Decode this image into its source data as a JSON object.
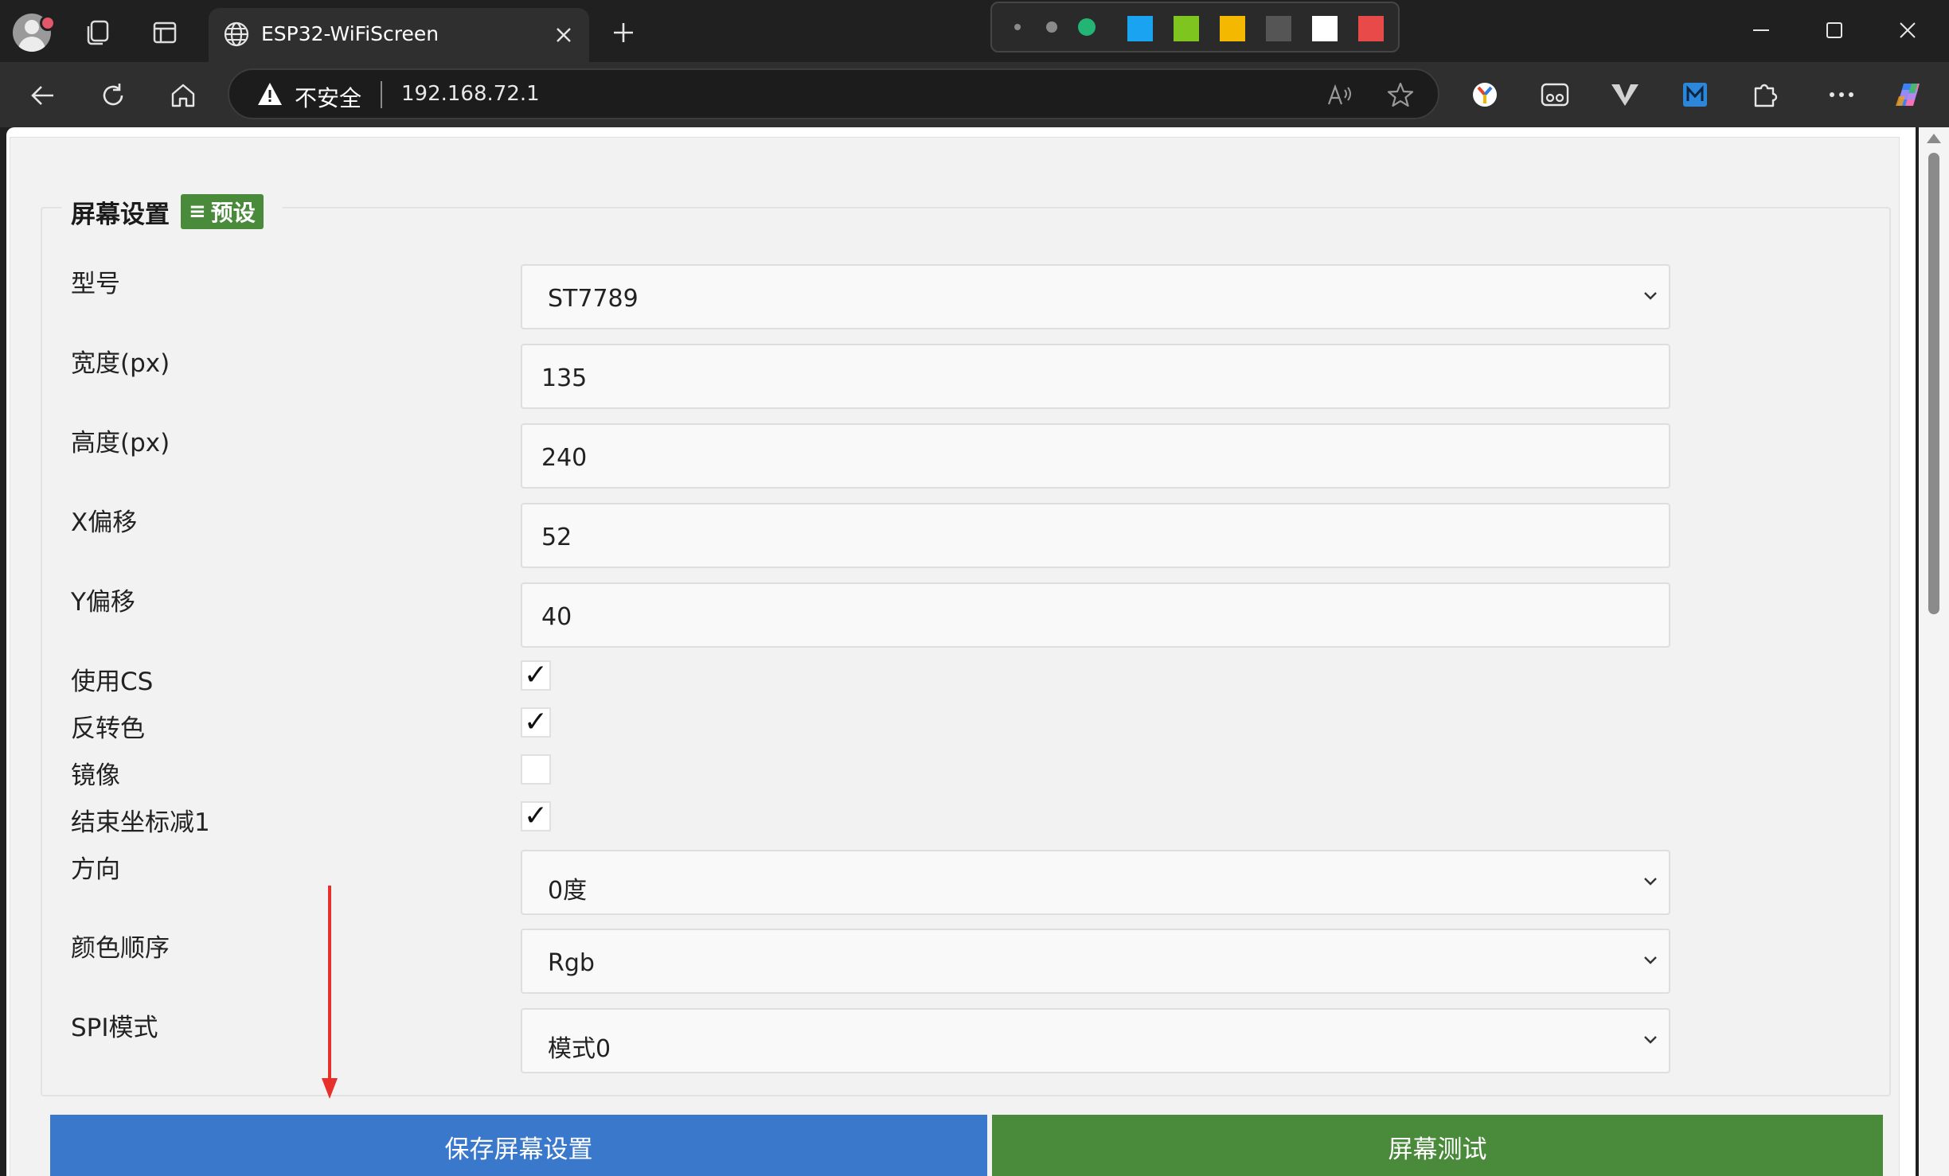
{
  "browser": {
    "tab_title": "ESP32-WiFiScreen",
    "security_label": "不安全",
    "url": "192.168.72.1",
    "palette_colors": [
      "#1aa3f0",
      "#7ec51f",
      "#f5b800",
      "#555555",
      "#ffffff",
      "#e84a4a"
    ]
  },
  "settings": {
    "legend_title": "屏幕设置",
    "preset_glyph": "≡",
    "preset_label": "预设",
    "model_label": "型号",
    "model_value": "ST7789",
    "width_label": "宽度(px)",
    "width_value": "135",
    "height_label": "高度(px)",
    "height_value": "240",
    "xoffset_label": "X偏移",
    "xoffset_value": "52",
    "yoffset_label": "Y偏移",
    "yoffset_value": "40",
    "use_cs_label": "使用CS",
    "use_cs_checked": true,
    "invert_label": "反转色",
    "invert_checked": true,
    "mirror_label": "镜像",
    "mirror_checked": false,
    "end_minus_label": "结束坐标减1",
    "end_minus_checked": true,
    "rotation_label": "方向",
    "rotation_value": "0度",
    "color_order_label": "颜色顺序",
    "color_order_value": "Rgb",
    "spi_label": "SPI模式",
    "spi_value": "模式0",
    "check_mark": "✓"
  },
  "actions": {
    "save_label": "保存屏幕设置",
    "test_label": "屏幕测试"
  },
  "colors": {
    "save_button": "#3a78cc",
    "test_button": "#4a8a3b",
    "annotation_arrow": "#e8302a"
  }
}
